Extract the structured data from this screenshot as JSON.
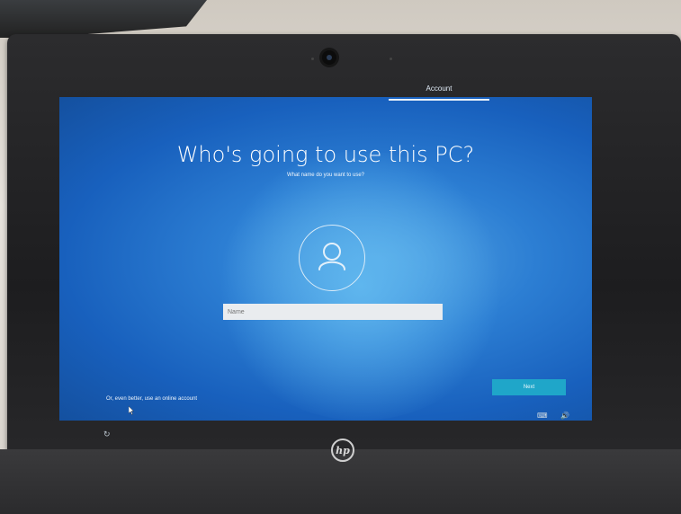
{
  "oobe": {
    "step_label": "Account",
    "heading": "Who's going to use this PC?",
    "subheading": "What name do you want to use?",
    "name_placeholder": "Name",
    "next_label": "Next",
    "online_account_link": "Or, even better, use an online account"
  },
  "hardware": {
    "logo_text": "hp"
  },
  "icons": {
    "user": "user-avatar-icon",
    "ease_of_access": "ease-of-access-icon",
    "keyboard": "keyboard-layout-icon",
    "volume": "volume-icon",
    "cursor": "mouse-pointer-icon"
  },
  "colors": {
    "screen_blue": "#2c7ed3",
    "next_button": "#1fa6c9"
  }
}
